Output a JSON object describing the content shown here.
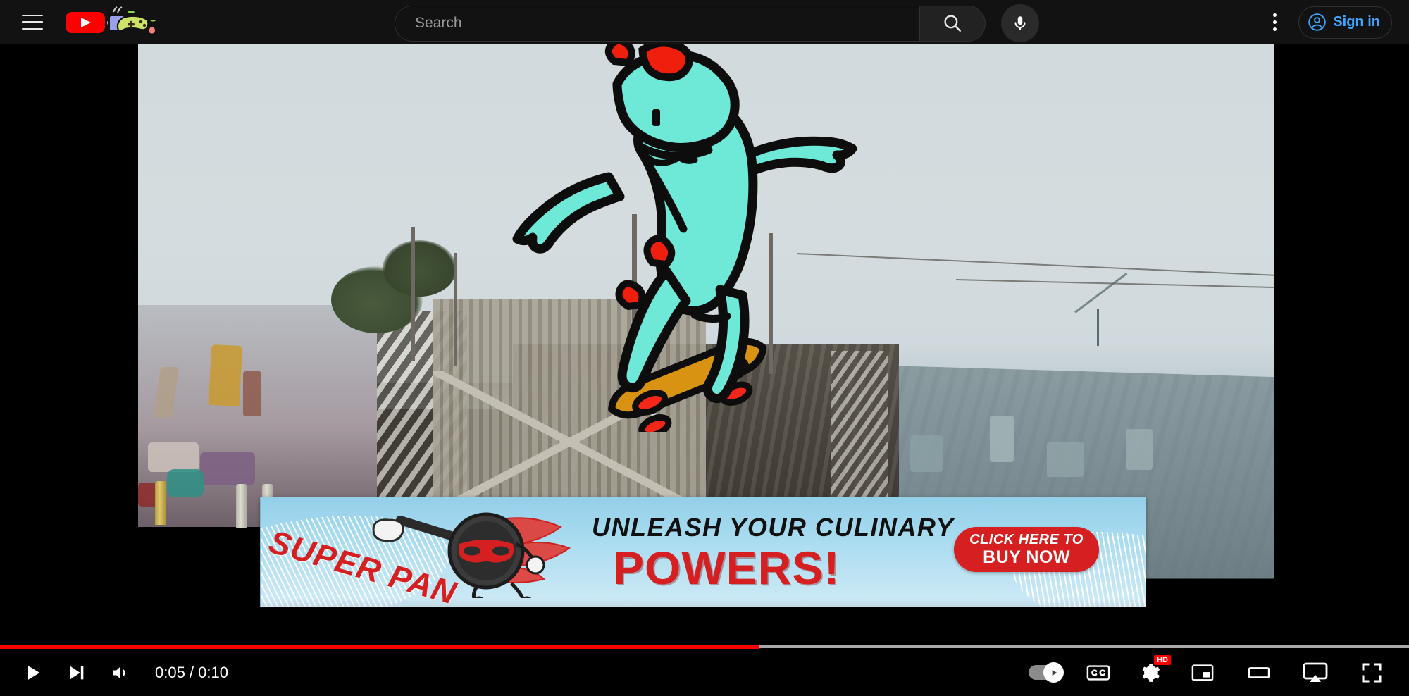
{
  "header": {
    "menu_icon": "hamburger-menu-icon",
    "logo": {
      "name": "youtube-logo",
      "country_code": ""
    },
    "doodle_icon": "coffee-cup-gamepad-doodle-icon",
    "search": {
      "placeholder": "Search",
      "value": "",
      "button_icon": "search-icon",
      "mic_icon": "microphone-icon"
    },
    "kebab_icon": "more-vertical-icon",
    "signin": {
      "label": "Sign in",
      "icon": "account-circle-icon",
      "color": "#3ea6ff"
    }
  },
  "player": {
    "progress": {
      "played_percent": 53.9,
      "loaded_percent": 100,
      "played_color": "#ff0000"
    },
    "controls": {
      "play_icon": "play-icon",
      "next_icon": "next-track-icon",
      "volume_icon": "volume-icon",
      "time_display": "0:05 / 0:10",
      "current_time": "0:05",
      "duration": "0:10",
      "autoplay_icon": "autoplay-toggle-icon",
      "autoplay_state": "on",
      "subtitles_icon": "closed-captions-icon",
      "settings_icon": "settings-gear-icon",
      "quality_badge": "HD",
      "miniplayer_icon": "miniplayer-icon",
      "theater_icon": "theater-mode-icon",
      "cast_icon": "cast-airplay-icon",
      "fullscreen_icon": "fullscreen-icon"
    },
    "scene": {
      "description": "skateboarding cartoon dinosaur at a skate park",
      "character_color": "#6ee9d8",
      "character_accent": "#f01f0d",
      "skateboard_color": "#d99313",
      "skateboard_wheel_color": "#f4261a"
    }
  },
  "ad": {
    "brand": "SUPER PAN",
    "headline": "UNLEASH YOUR CULINARY",
    "subhead": "POWERS!",
    "cta_line1": "CLICK HERE TO",
    "cta_line2": "BUY NOW",
    "cta_color": "#d51f20",
    "background_color": "#aadcf0",
    "mascot_icon": "flying-masked-frying-pan-icon"
  }
}
